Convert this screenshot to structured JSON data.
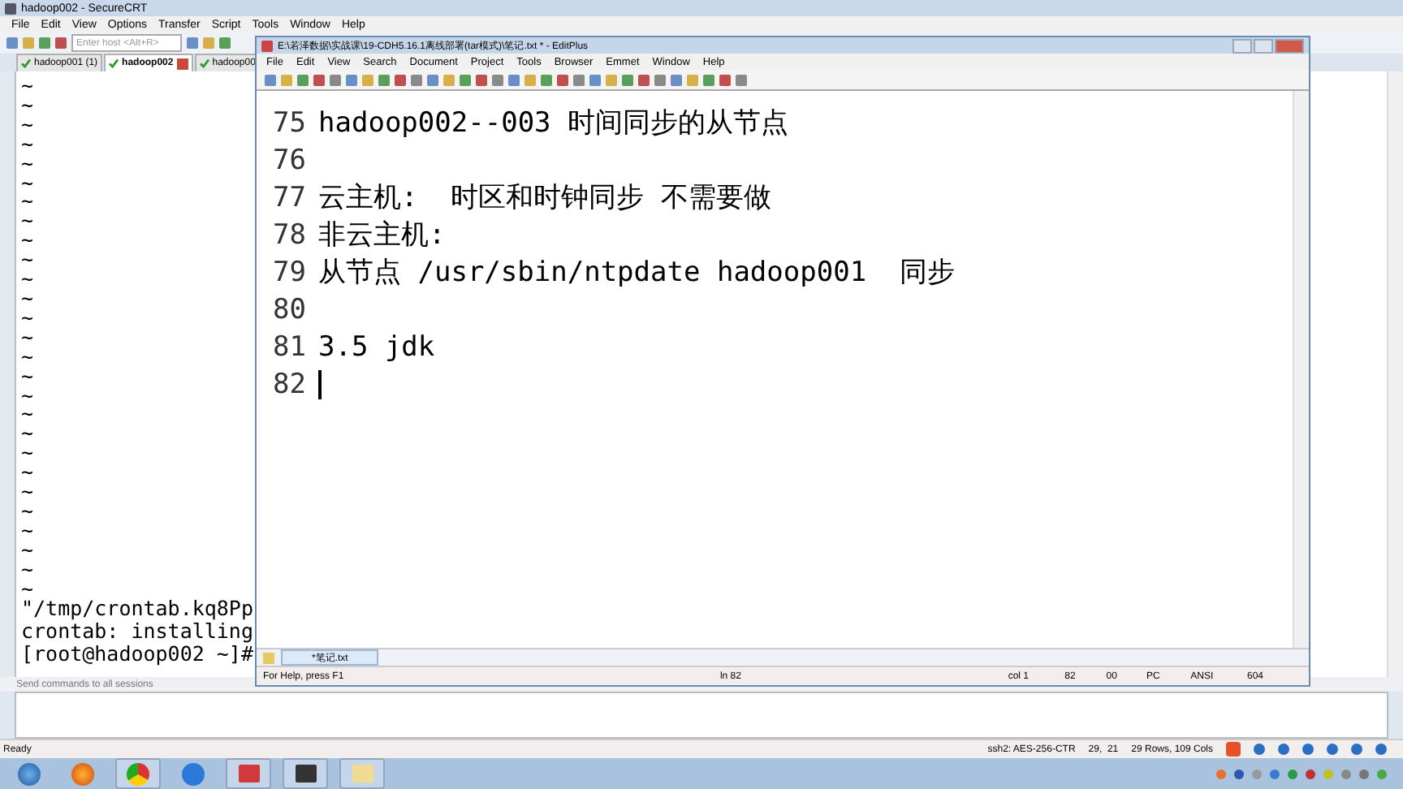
{
  "securecrt": {
    "title": "hadoop002 - SecureCRT",
    "menu": [
      "File",
      "Edit",
      "View",
      "Options",
      "Transfer",
      "Script",
      "Tools",
      "Window",
      "Help"
    ],
    "host_field": {
      "placeholder": "Enter host <Alt+R>"
    },
    "tabs": [
      {
        "label": "hadoop001 (1)",
        "selected": false
      },
      {
        "label": "hadoop002",
        "selected": true
      },
      {
        "label": "hadoop00",
        "selected": false
      }
    ],
    "terminal_lines": [
      "~",
      "~",
      "~",
      "~",
      "~",
      "~",
      "~",
      "~",
      "~",
      "~",
      "~",
      "~",
      "~",
      "~",
      "~",
      "~",
      "~",
      "~",
      "~",
      "~",
      "~",
      "~",
      "~",
      "~",
      "~",
      "~",
      "~",
      "\"/tmp/crontab.kq8Pp",
      "crontab: installing",
      "[root@hadoop002 ~]#"
    ],
    "send_bar": "Send commands to all sessions",
    "status": {
      "text": "Ready",
      "cipher": "ssh2: AES-256-CTR",
      "position": "29,  21",
      "size": "29 Rows, 109 Cols"
    }
  },
  "editplus": {
    "title": "E:\\若泽数据\\实战课\\19-CDH5.16.1离线部署(tar模式)\\笔记.txt * - EditPlus",
    "menu": [
      "File",
      "Edit",
      "View",
      "Search",
      "Document",
      "Project",
      "Tools",
      "Browser",
      "Emmet",
      "Window",
      "Help"
    ],
    "lines": [
      {
        "number": "75",
        "text": "hadoop002--003 时间同步的从节点",
        "cursor": false
      },
      {
        "number": "76",
        "cursor": false
      },
      {
        "number": "77",
        "text": "云主机:  时区和时钟同步 不需要做",
        "cursor": false
      },
      {
        "number": "78",
        "text": "非云主机:",
        "cursor": false
      },
      {
        "number": "79",
        "text": "从节点 /usr/sbin/ntpdate hadoop001  同步",
        "cursor": false
      },
      {
        "number": "80",
        "cursor": false
      },
      {
        "number": "81",
        "text": "3.5 jdk",
        "cursor": false
      },
      {
        "number": "82",
        "cursor": true
      }
    ],
    "doc_tab": {
      "label": "*笔记.txt",
      "selected": true
    },
    "status": [
      "For Help, press F1",
      "ln 82",
      "col 1",
      "82",
      "00",
      "PC",
      "ANSI",
      "604"
    ]
  }
}
